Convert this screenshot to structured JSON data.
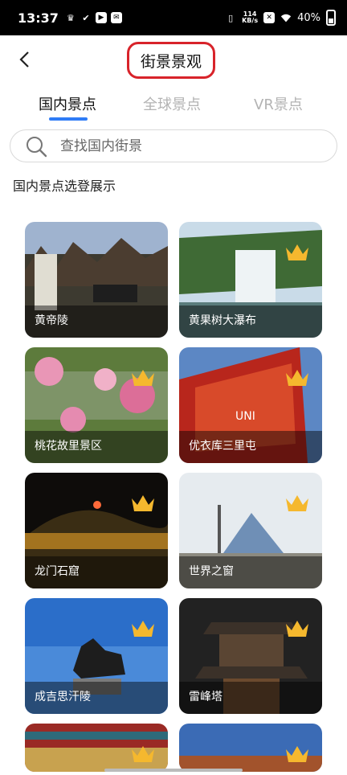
{
  "status_bar": {
    "time": "13:37",
    "net_speed_value": "114",
    "net_speed_unit": "KB/s",
    "battery": "40%"
  },
  "header": {
    "title": "街景景观"
  },
  "tabs": [
    {
      "label": "国内景点",
      "active": true
    },
    {
      "label": "全球景点",
      "active": false
    },
    {
      "label": "VR景点",
      "active": false
    }
  ],
  "search": {
    "placeholder": "查找国内街景"
  },
  "section": {
    "title": "国内景点选登展示"
  },
  "cards": [
    {
      "label": "黄帝陵",
      "crown": false
    },
    {
      "label": "黄果树大瀑布",
      "crown": true
    },
    {
      "label": "桃花故里景区",
      "crown": true
    },
    {
      "label": "优衣库三里屯",
      "crown": true
    },
    {
      "label": "龙门石窟",
      "crown": true
    },
    {
      "label": "世界之窗",
      "crown": true
    },
    {
      "label": "成吉思汗陵",
      "crown": true
    },
    {
      "label": "雷峰塔",
      "crown": true
    },
    {
      "label": "",
      "crown": true
    },
    {
      "label": "",
      "crown": true
    }
  ],
  "colors": {
    "accent": "#2f7cf6",
    "highlight_box": "#d8232a",
    "crown": "#f5b82e"
  }
}
